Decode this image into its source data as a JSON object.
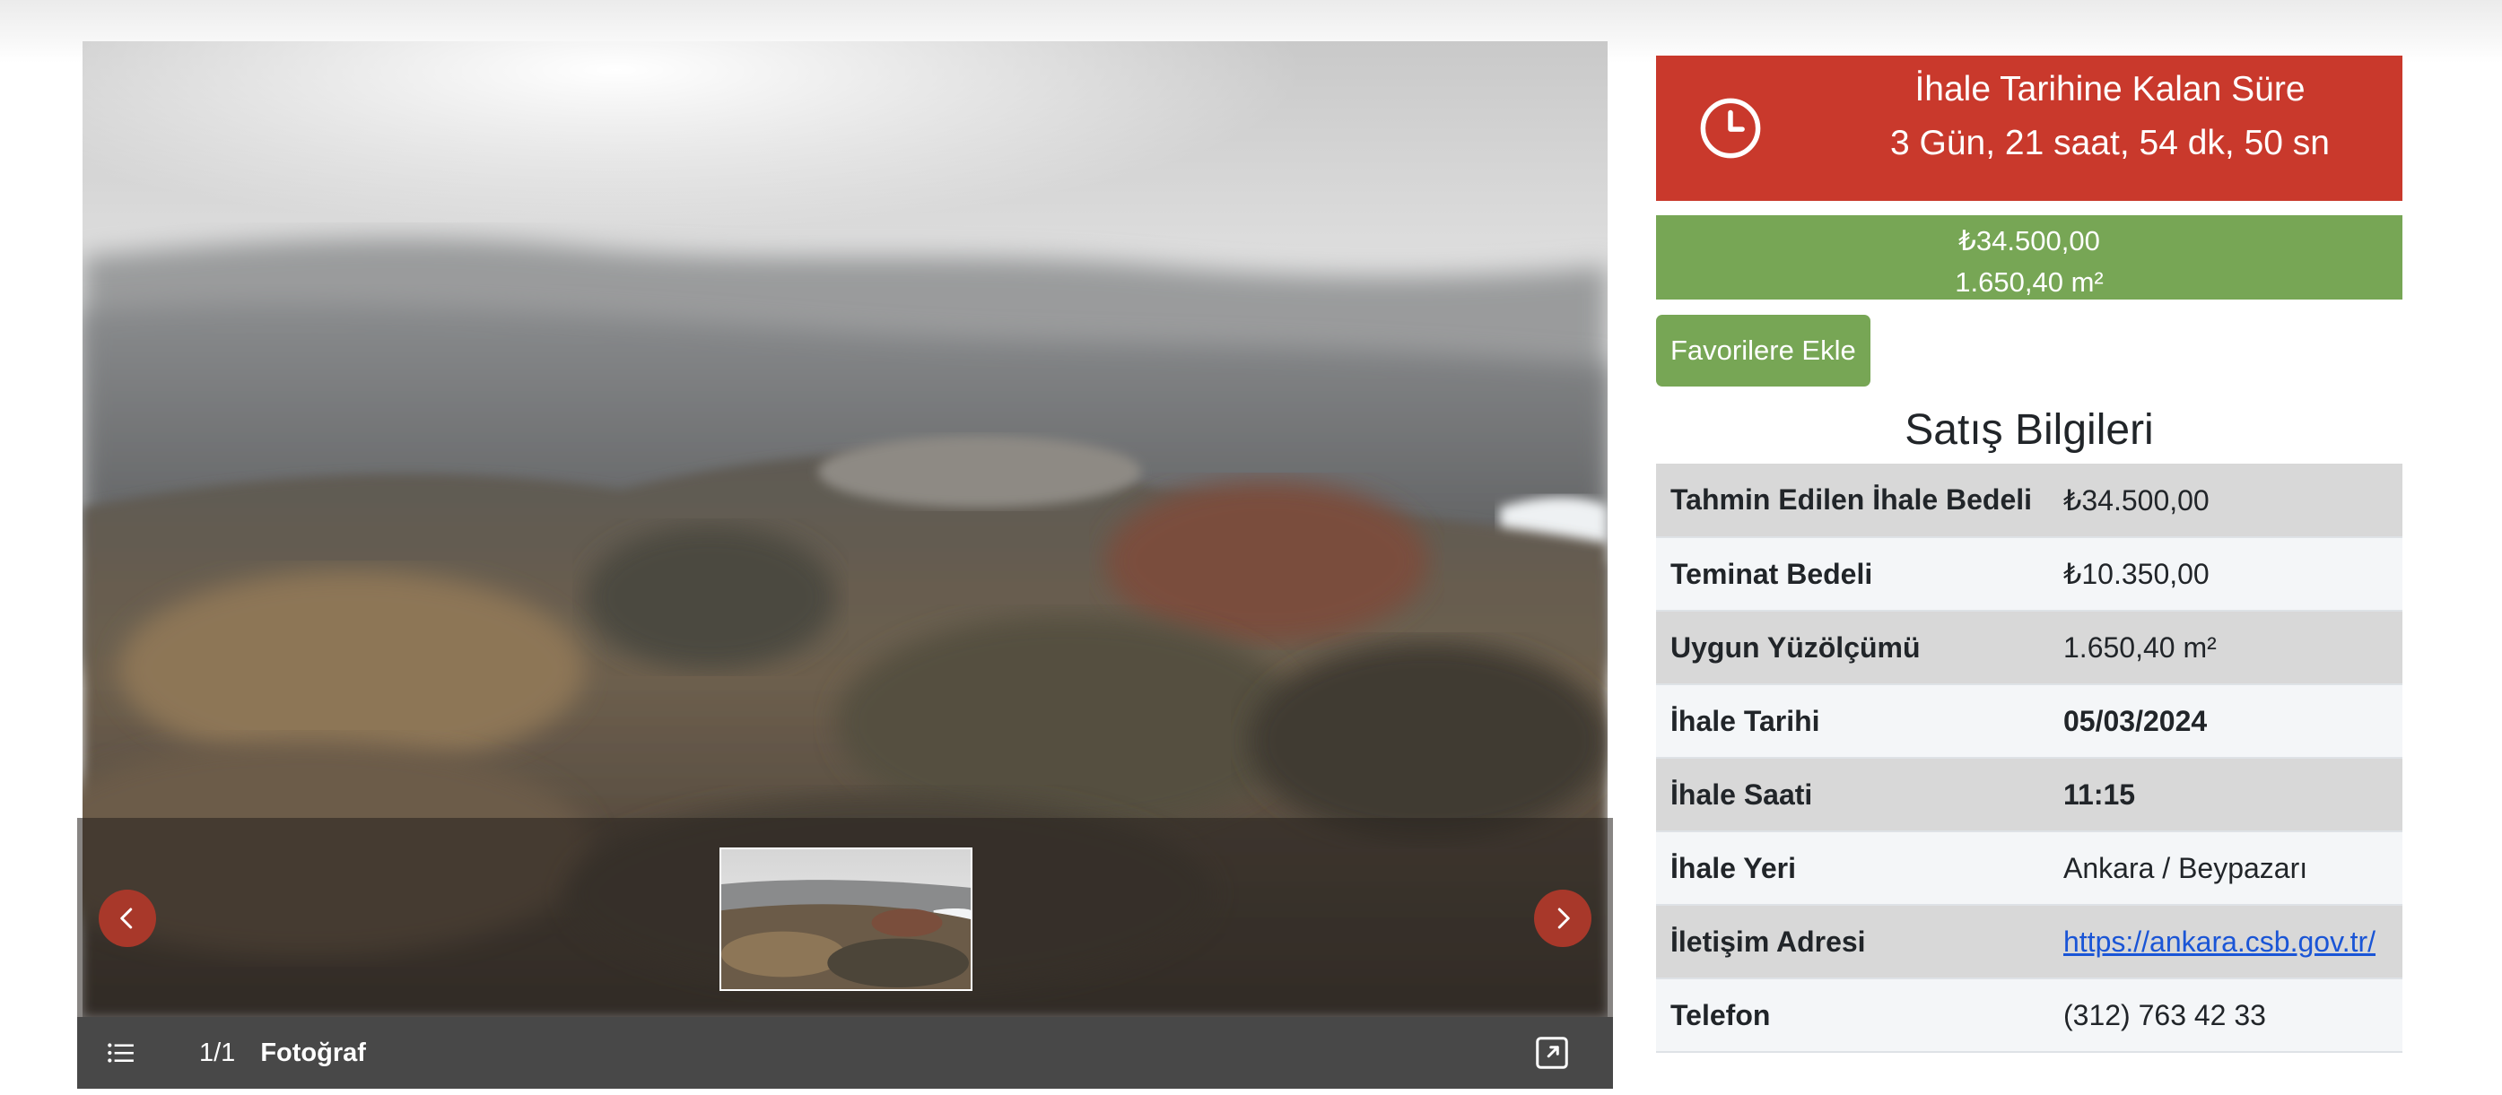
{
  "gallery": {
    "counter": "1/1",
    "caption": "Fotoğraf"
  },
  "countdown": {
    "title": "İhale Tarihine Kalan Süre",
    "value": "3 Gün, 21 saat, 54 dk, 50 sn"
  },
  "price_box": {
    "price": "₺34.500,00",
    "area": "1.650,40 m²"
  },
  "favorite_button": "Favorilere Ekle",
  "sale_info": {
    "heading": "Satış Bilgileri",
    "rows": [
      {
        "label": "Tahmin Edilen İhale Bedeli",
        "value": "₺34.500,00"
      },
      {
        "label": "Teminat Bedeli",
        "value": "₺10.350,00"
      },
      {
        "label": "Uygun Yüzölçümü",
        "value": "1.650,40 m²"
      },
      {
        "label": "İhale Tarihi",
        "value": "05/03/2024"
      },
      {
        "label": "İhale Saati",
        "value": "11:15"
      },
      {
        "label": "İhale Yeri",
        "value": "Ankara / Beypazarı"
      },
      {
        "label": "İletişim Adresi",
        "value": "https://ankara.csb.gov.tr/"
      },
      {
        "label": "Telefon",
        "value": "(312) 763 42 33"
      }
    ]
  },
  "colors": {
    "countdown_bg": "#c9392c",
    "price_bg": "#77a655",
    "nav_arrow_bg": "#a8382a",
    "link": "#1a55d6"
  }
}
